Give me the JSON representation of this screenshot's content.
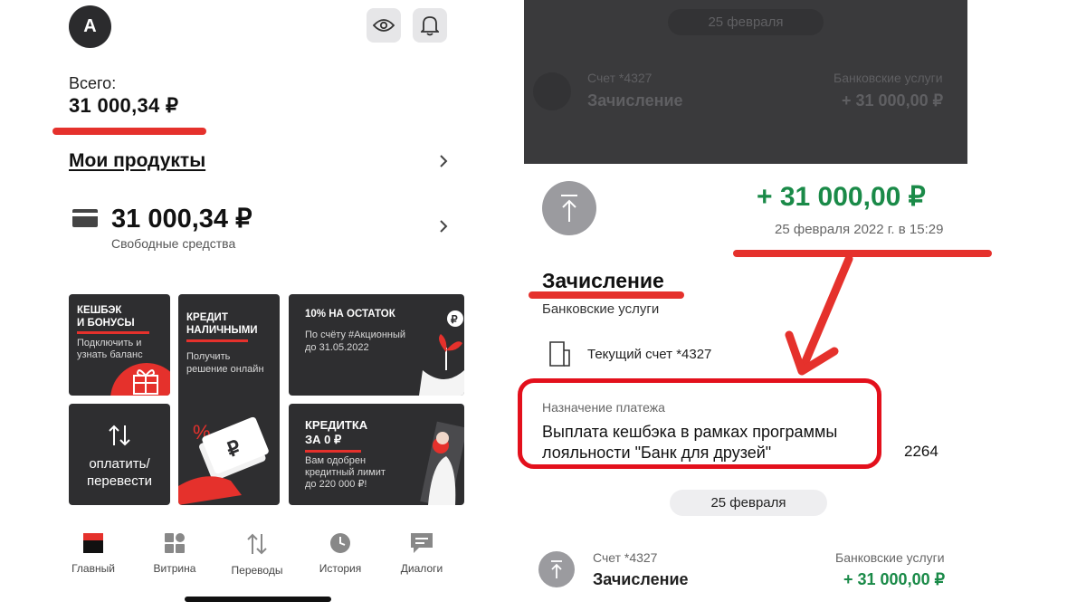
{
  "left": {
    "avatar_letter": "А",
    "total_label": "Всего:",
    "total_value": "31 000,34 ₽",
    "products_title": "Мои продукты",
    "balance_value": "31 000,34 ₽",
    "balance_caption": "Свободные средства",
    "tiles": {
      "cashback": {
        "title_line1": "КЕШБЭК",
        "title_line2": "И БОНУСЫ",
        "sub_line1": "Подключить и",
        "sub_line2": "узнать баланс"
      },
      "credit": {
        "title_line1": "КРЕДИТ",
        "title_line2": "НАЛИЧНЫМИ",
        "sub_line1": "Получить",
        "sub_line2": "решение онлайн"
      },
      "percent": {
        "title": "10% НА ОСТАТОК",
        "sub_line1": "По счёту #Акционный",
        "sub_line2": "до 31.05.2022"
      },
      "transfer": {
        "label_line1": "оплатить/",
        "label_line2": "перевести"
      },
      "card": {
        "title_line1": "КРЕДИТКА",
        "title_line2": "ЗА 0 ₽",
        "sub_line1": "Вам одобрен",
        "sub_line2": "кредитный лимит",
        "sub_line3": "до 220 000 ₽!"
      }
    },
    "nav": [
      "Главный",
      "Витрина",
      "Переводы",
      "История",
      "Диалоги"
    ]
  },
  "right": {
    "overlay": {
      "date_pill": "25 февраля",
      "account": "Счет *4327",
      "title": "Зачисление",
      "category": "Банковские услуги",
      "amount": "+ 31 000,00 ₽"
    },
    "amount": "+ 31 000,00 ₽",
    "datetime": "25 февраля 2022 г. в 15:29",
    "title": "Зачисление",
    "category": "Банковские услуги",
    "account": "Текущий счет *4327",
    "purpose_label": "Назначение платежа",
    "purpose_text": "Выплата кешбэка в рамках программы лояльности \"Банк для друзей\"",
    "side_number": "2264",
    "date_pill": "25 февраля",
    "row": {
      "account": "Счет *4327",
      "title": "Зачисление",
      "category": "Банковские услуги",
      "amount": "+ 31 000,00 ₽"
    }
  },
  "colors": {
    "accent_red": "#e5312c",
    "positive_green": "#1a8a48",
    "tile_dark": "#2e2e30"
  }
}
